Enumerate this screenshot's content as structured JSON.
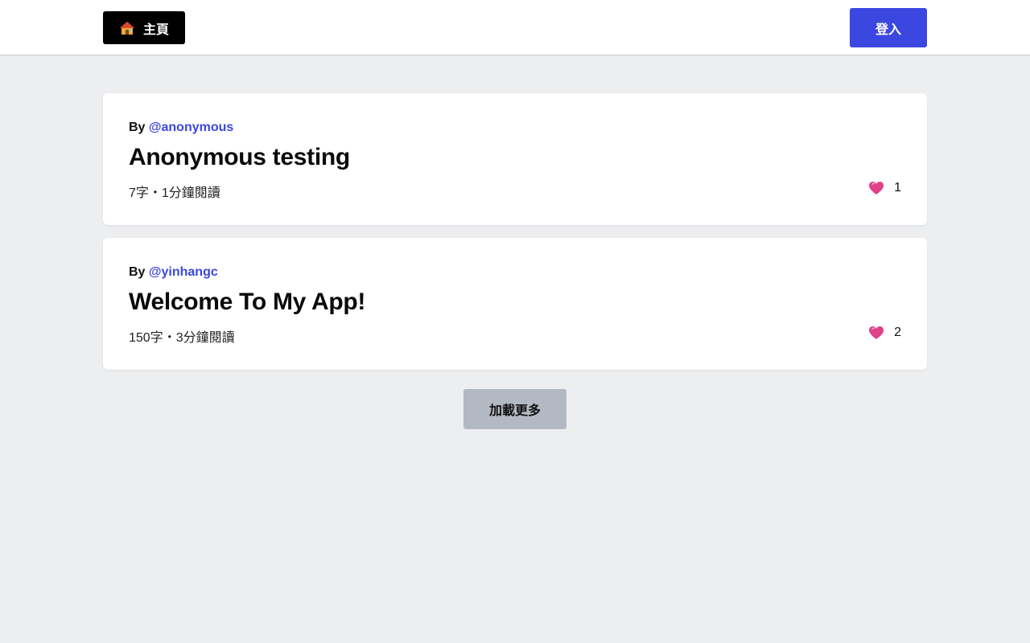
{
  "header": {
    "home_label": "主頁",
    "home_icon": "house-icon",
    "login_label": "登入"
  },
  "colors": {
    "accent": "#3b47e0",
    "page_background": "#edeef0",
    "load_more_background": "#b2b9c2",
    "heart": "#e0418a"
  },
  "posts": [
    {
      "by_label": "By",
      "author": "@anonymous",
      "title": "Anonymous testing",
      "meta": "7字・1分鐘閱讀",
      "like_icon": "heart-icon",
      "likes": "1"
    },
    {
      "by_label": "By",
      "author": "@yinhangc",
      "title": "Welcome To My App!",
      "meta": "150字・3分鐘閱讀",
      "like_icon": "heart-icon",
      "likes": "2"
    }
  ],
  "load_more_label": "加載更多"
}
